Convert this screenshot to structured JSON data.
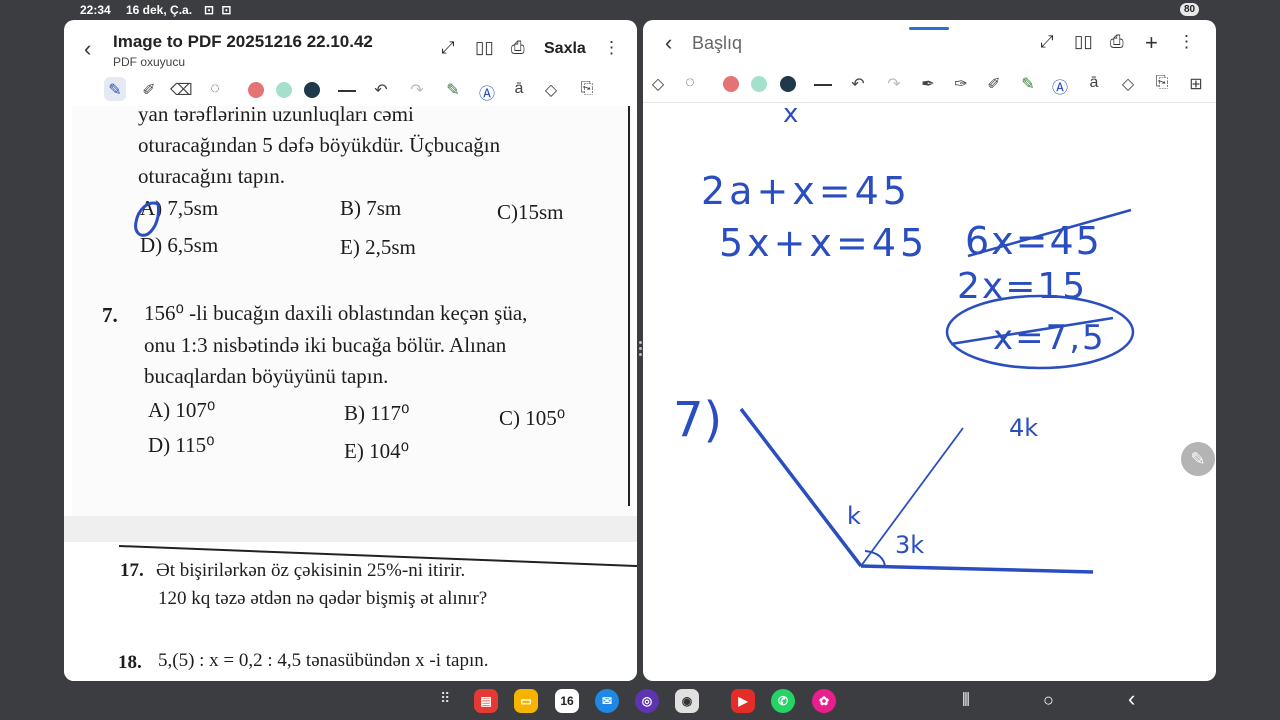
{
  "status": {
    "time": "22:34",
    "date": "16 dek, Ç.a.",
    "battery": "80",
    "icons": "⊡ ⊡"
  },
  "left": {
    "title": "Image to PDF 20251216 22.10.42",
    "subtitle": "PDF oxuyucu",
    "save": "Saxla",
    "doc": {
      "line1": "yan tərəflərinin uzunluqları cəmi",
      "line2": "oturacağından 5 dəfə böyükdür. Üçbucağın",
      "line3": "oturacağını tapın.",
      "q6": {
        "A": "A) 7,5sm",
        "B": "B)  7sm",
        "C": "C)15sm",
        "D": "D)  6,5sm",
        "E": "E)  2,5sm"
      },
      "q7": {
        "num": "7.",
        "l1": "156⁰ -li bucağın daxili oblastından keçən şüa,",
        "l2": "onu 1:3 nisbətində iki bucağa bölür. Alınan",
        "l3": "bucaqlardan böyüyünü tapın.",
        "A": "A) 107⁰",
        "B": "B)  117⁰",
        "C": "C)  105⁰",
        "D": "D)  115⁰",
        "E": "E)  104⁰"
      }
    },
    "doc2": {
      "q17num": "17.",
      "q17l1": "Ət bişirilərkən öz çəkisinin 25%-ni itirir.",
      "q17l2": "120 kq təzə ətdən nə qədər bişmiş ət alınır?",
      "q18num": "18.",
      "q18": "5,(5) : x = 0,2 : 4,5  tənasübündən  x -i tapın."
    }
  },
  "right": {
    "title": "Başlıq",
    "handwriting": {
      "x_top": "x",
      "eq1": "2a+x=45",
      "eq2": "5x+x=45",
      "eq3": "6x=45",
      "eq4": "2x=15",
      "eq5": "x=7,5",
      "label7": "7)",
      "k": "k",
      "k4": "4k",
      "k3": "3k"
    }
  },
  "colors": {
    "ink": "#2a4ec0",
    "red": "#e57373",
    "mint": "#a5e0cc",
    "dark": "#1e3a4a"
  },
  "nav": {
    "calendar_day": "16"
  }
}
